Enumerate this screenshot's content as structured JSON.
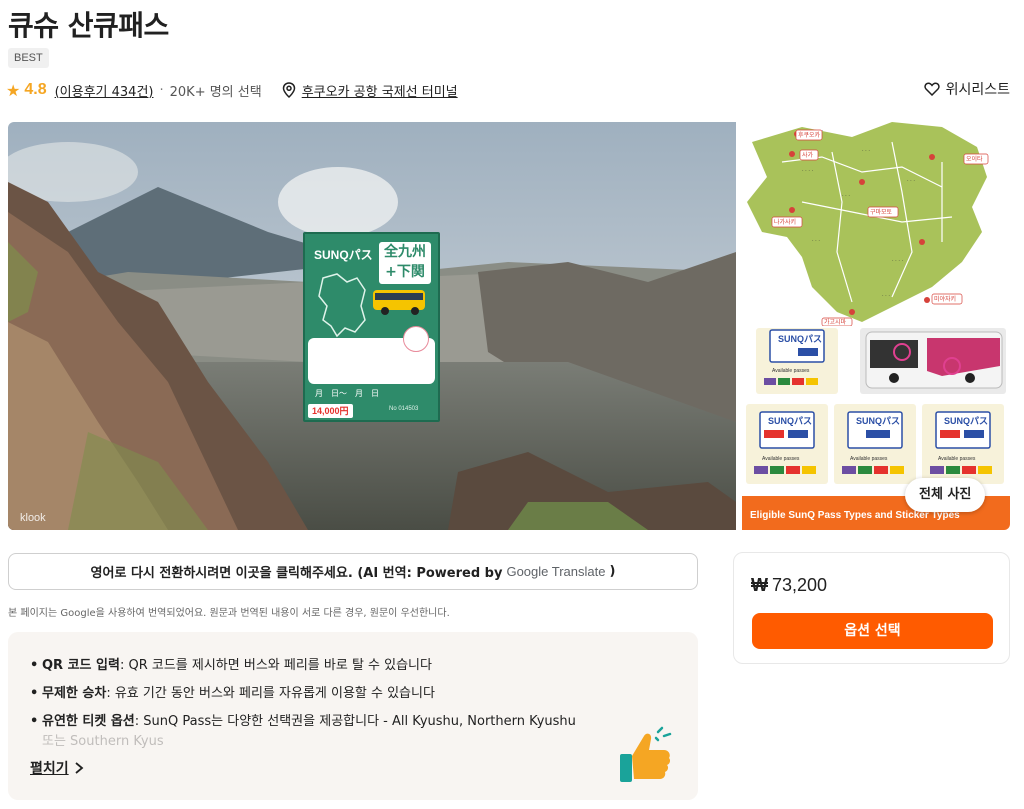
{
  "product": {
    "title": "큐슈 산큐패스",
    "badge": "BEST",
    "rating": "4.8",
    "reviews": "(이용후기 434건)",
    "bullet": "·",
    "selected_count": "20K+ 명의 선택",
    "location": "후쿠오카 공항 국제선 터미널"
  },
  "wishlist": {
    "label": "위시리스트",
    "icon": "heart-icon"
  },
  "gallery": {
    "main_pass": {
      "brand": "SUNQパス",
      "region_line1": "全九州",
      "region_line2": "+下関",
      "date_text": "月　日～　月　日",
      "price_tag": "14,000円",
      "serial": "No 014503"
    },
    "watermark": "klook",
    "map_labels": [
      "후쿠오카",
      "사가",
      "오이타",
      "나가사키",
      "구마모토",
      "미야자키",
      "가고시마"
    ],
    "pass_card_brand": "SUNQパス",
    "pass_card_caption": "Available passes",
    "orange_banner": "Eligible SunQ Pass Types and Sticker Types",
    "all_photos_label": "전체 사진"
  },
  "translation": {
    "bar_text": "영어로 다시 전환하시려면 이곳을 클릭해주세요. (AI 번역: Powered by",
    "google": "Google",
    "translate": "Translate",
    "bar_end": ")",
    "note": "본 페이지는 Google을 사용하여 번역되었어요. 원문과 번역된 내용이 서로 다른 경우, 원문이 우선한니다."
  },
  "highlights": {
    "items": [
      {
        "title": "QR 코드 입력",
        "text": ": QR 코드를 제시하면 버스와 페리를 바로 탈 수 있습니다"
      },
      {
        "title": "무제한 승차",
        "text": ": 유효 기간 동안 버스와 페리를 자유롭게 이용할 수 있습니다"
      },
      {
        "title": "유연한 티켓 옵션",
        "text": ": SunQ Pass는 다양한 선택권을 제공합니다 - All Kyushu, Northern Kyushu"
      }
    ],
    "faded": "또는 Southern Kyus",
    "expand_label": "펼치기"
  },
  "booking": {
    "currency": "₩",
    "price": "73,200",
    "button": "옵션 선택"
  },
  "colors": {
    "accent": "#ff5b00",
    "star": "#f5a623",
    "pass_green": "#2e8b6a"
  }
}
